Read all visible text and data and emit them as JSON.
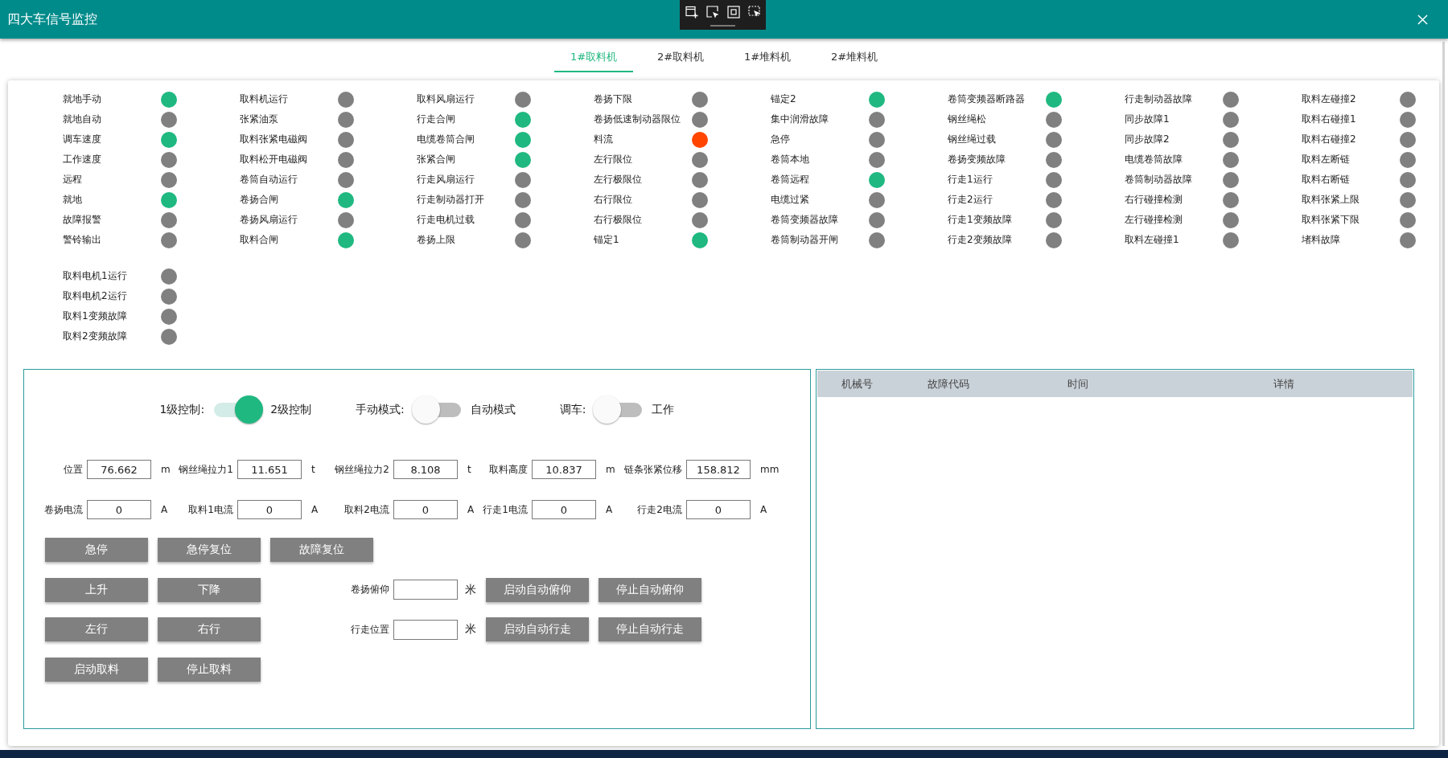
{
  "window": {
    "title": "四大车信号监控"
  },
  "tabs": [
    {
      "label": "1#取料机",
      "selected": true
    },
    {
      "label": "2#取料机",
      "selected": false
    },
    {
      "label": "1#堆料机",
      "selected": false
    },
    {
      "label": "2#堆料机",
      "selected": false
    }
  ],
  "signal_blocks": [
    {
      "columns": [
        {
          "items": [
            {
              "label": "就地手动",
              "color": "#1fb880"
            },
            {
              "label": "就地自动",
              "color": "#808080"
            },
            {
              "label": "调车速度",
              "color": "#1fb880"
            },
            {
              "label": "工作速度",
              "color": "#808080"
            },
            {
              "label": "远程",
              "color": "#808080"
            },
            {
              "label": "就地",
              "color": "#1fb880"
            },
            {
              "label": "故障报警",
              "color": "#808080"
            },
            {
              "label": "警铃输出",
              "color": "#808080"
            }
          ]
        },
        {
          "items": [
            {
              "label": "取料机运行",
              "color": "#808080"
            },
            {
              "label": "张紧油泵",
              "color": "#808080"
            },
            {
              "label": "取料张紧电磁阀",
              "color": "#808080"
            },
            {
              "label": "取料松开电磁阀",
              "color": "#808080"
            },
            {
              "label": "卷筒自动运行",
              "color": "#808080"
            },
            {
              "label": "卷扬合闸",
              "color": "#1fb880"
            },
            {
              "label": "卷扬风扇运行",
              "color": "#808080"
            },
            {
              "label": "取料合闸",
              "color": "#1fb880"
            }
          ]
        },
        {
          "items": [
            {
              "label": "取料风扇运行",
              "color": "#808080"
            },
            {
              "label": "行走合闸",
              "color": "#1fb880"
            },
            {
              "label": "电缆卷筒合闸",
              "color": "#1fb880"
            },
            {
              "label": "张紧合闸",
              "color": "#1fb880"
            },
            {
              "label": "行走风扇运行",
              "color": "#808080"
            },
            {
              "label": "行走制动器打开",
              "color": "#808080"
            },
            {
              "label": "行走电机过载",
              "color": "#808080"
            },
            {
              "label": "卷扬上限",
              "color": "#808080"
            }
          ]
        },
        {
          "items": [
            {
              "label": "卷扬下限",
              "color": "#808080"
            },
            {
              "label": "卷扬低速制动器限位",
              "color": "#808080"
            },
            {
              "label": "料流",
              "color": "#ff4500"
            },
            {
              "label": "左行限位",
              "color": "#808080"
            },
            {
              "label": "左行极限位",
              "color": "#808080"
            },
            {
              "label": "右行限位",
              "color": "#808080"
            },
            {
              "label": "右行极限位",
              "color": "#808080"
            },
            {
              "label": "锚定1",
              "color": "#1fb880"
            }
          ]
        },
        {
          "items": [
            {
              "label": "锚定2",
              "color": "#1fb880"
            },
            {
              "label": "集中润滑故障",
              "color": "#808080"
            },
            {
              "label": "急停",
              "color": "#808080"
            },
            {
              "label": "卷筒本地",
              "color": "#808080"
            },
            {
              "label": "卷筒远程",
              "color": "#1fb880"
            },
            {
              "label": "电缆过紧",
              "color": "#808080"
            },
            {
              "label": "卷筒变频器故障",
              "color": "#808080"
            },
            {
              "label": "卷筒制动器开闸",
              "color": "#808080"
            }
          ]
        },
        {
          "items": [
            {
              "label": "卷筒变频器断路器",
              "color": "#1fb880"
            },
            {
              "label": "钢丝绳松",
              "color": "#808080"
            },
            {
              "label": "钢丝绳过载",
              "color": "#808080"
            },
            {
              "label": "卷扬变频故障",
              "color": "#808080"
            },
            {
              "label": "行走1运行",
              "color": "#808080"
            },
            {
              "label": "行走2运行",
              "color": "#808080"
            },
            {
              "label": "行走1变频故障",
              "color": "#808080"
            },
            {
              "label": "行走2变频故障",
              "color": "#808080"
            }
          ]
        },
        {
          "items": [
            {
              "label": "行走制动器故障",
              "color": "#808080"
            },
            {
              "label": "同步故障1",
              "color": "#808080"
            },
            {
              "label": "同步故障2",
              "color": "#808080"
            },
            {
              "label": "电缆卷筒故障",
              "color": "#808080"
            },
            {
              "label": "卷筒制动器故障",
              "color": "#808080"
            },
            {
              "label": "右行碰撞检测",
              "color": "#808080"
            },
            {
              "label": "左行碰撞检测",
              "color": "#808080"
            },
            {
              "label": "取料左碰撞1",
              "color": "#808080"
            }
          ]
        },
        {
          "items": [
            {
              "label": "取料左碰撞2",
              "color": "#808080"
            },
            {
              "label": "取料右碰撞1",
              "color": "#808080"
            },
            {
              "label": "取料右碰撞2",
              "color": "#808080"
            },
            {
              "label": "取料左断链",
              "color": "#808080"
            },
            {
              "label": "取料右断链",
              "color": "#808080"
            },
            {
              "label": "取料张紧上限",
              "color": "#808080"
            },
            {
              "label": "取料张紧下限",
              "color": "#808080"
            },
            {
              "label": "堵料故障",
              "color": "#808080"
            }
          ]
        }
      ]
    },
    {
      "columns": [
        {
          "items": [
            {
              "label": "取料电机1运行",
              "color": "#808080"
            },
            {
              "label": "取料电机2运行",
              "color": "#808080"
            },
            {
              "label": "取料1变频故障",
              "color": "#808080"
            },
            {
              "label": "取料2变频故障",
              "color": "#808080"
            }
          ]
        }
      ]
    }
  ],
  "control_panel": {
    "switches": [
      {
        "label_left": "1级控制:",
        "label_right": "2级控制",
        "on": true
      },
      {
        "label_left": "手动模式:",
        "label_right": "自动模式",
        "on": false
      },
      {
        "label_left": "调车:",
        "label_right": "工作",
        "on": false
      }
    ],
    "reading_rows": [
      {
        "fields": [
          {
            "label": "位置",
            "value": "76.662",
            "unit": "m"
          },
          {
            "label": "钢丝绳拉力1",
            "value": "11.651",
            "unit": "t"
          },
          {
            "label": "钢丝绳拉力2",
            "value": "8.108",
            "unit": "t"
          },
          {
            "label": "取料高度",
            "value": "10.837",
            "unit": "m"
          },
          {
            "label": "链条张紧位移",
            "value": "158.812",
            "unit": "mm"
          }
        ]
      },
      {
        "fields": [
          {
            "label": "卷扬电流",
            "value": "0",
            "unit": "A"
          },
          {
            "label": "取料1电流",
            "value": "0",
            "unit": "A"
          },
          {
            "label": "取料2电流",
            "value": "0",
            "unit": "A"
          },
          {
            "label": "行走1电流",
            "value": "0",
            "unit": "A"
          },
          {
            "label": "行走2电流",
            "value": "0",
            "unit": "A"
          }
        ]
      }
    ],
    "button_rows": [
      {
        "items": [
          {
            "kind": "button",
            "label": "急停"
          },
          {
            "kind": "button",
            "label": "急停复位"
          },
          {
            "kind": "button",
            "label": "故障复位"
          }
        ]
      },
      {
        "items": [
          {
            "kind": "button",
            "label": "上升"
          },
          {
            "kind": "button",
            "label": "下降"
          },
          {
            "kind": "setpoint",
            "label": "卷扬俯仰",
            "unit": "米"
          },
          {
            "kind": "button",
            "label": "启动自动俯仰"
          },
          {
            "kind": "button",
            "label": "停止自动俯仰"
          }
        ]
      },
      {
        "items": [
          {
            "kind": "button",
            "label": "左行"
          },
          {
            "kind": "button",
            "label": "右行"
          },
          {
            "kind": "setpoint",
            "label": "行走位置",
            "unit": "米"
          },
          {
            "kind": "button",
            "label": "启动自动行走"
          },
          {
            "kind": "button",
            "label": "停止自动行走"
          }
        ]
      },
      {
        "items": [
          {
            "kind": "button",
            "label": "启动取料"
          },
          {
            "kind": "button",
            "label": "停止取料"
          }
        ]
      }
    ]
  },
  "fault_table": {
    "columns": [
      "机械号",
      "故障代码",
      "时间",
      "详情"
    ]
  }
}
